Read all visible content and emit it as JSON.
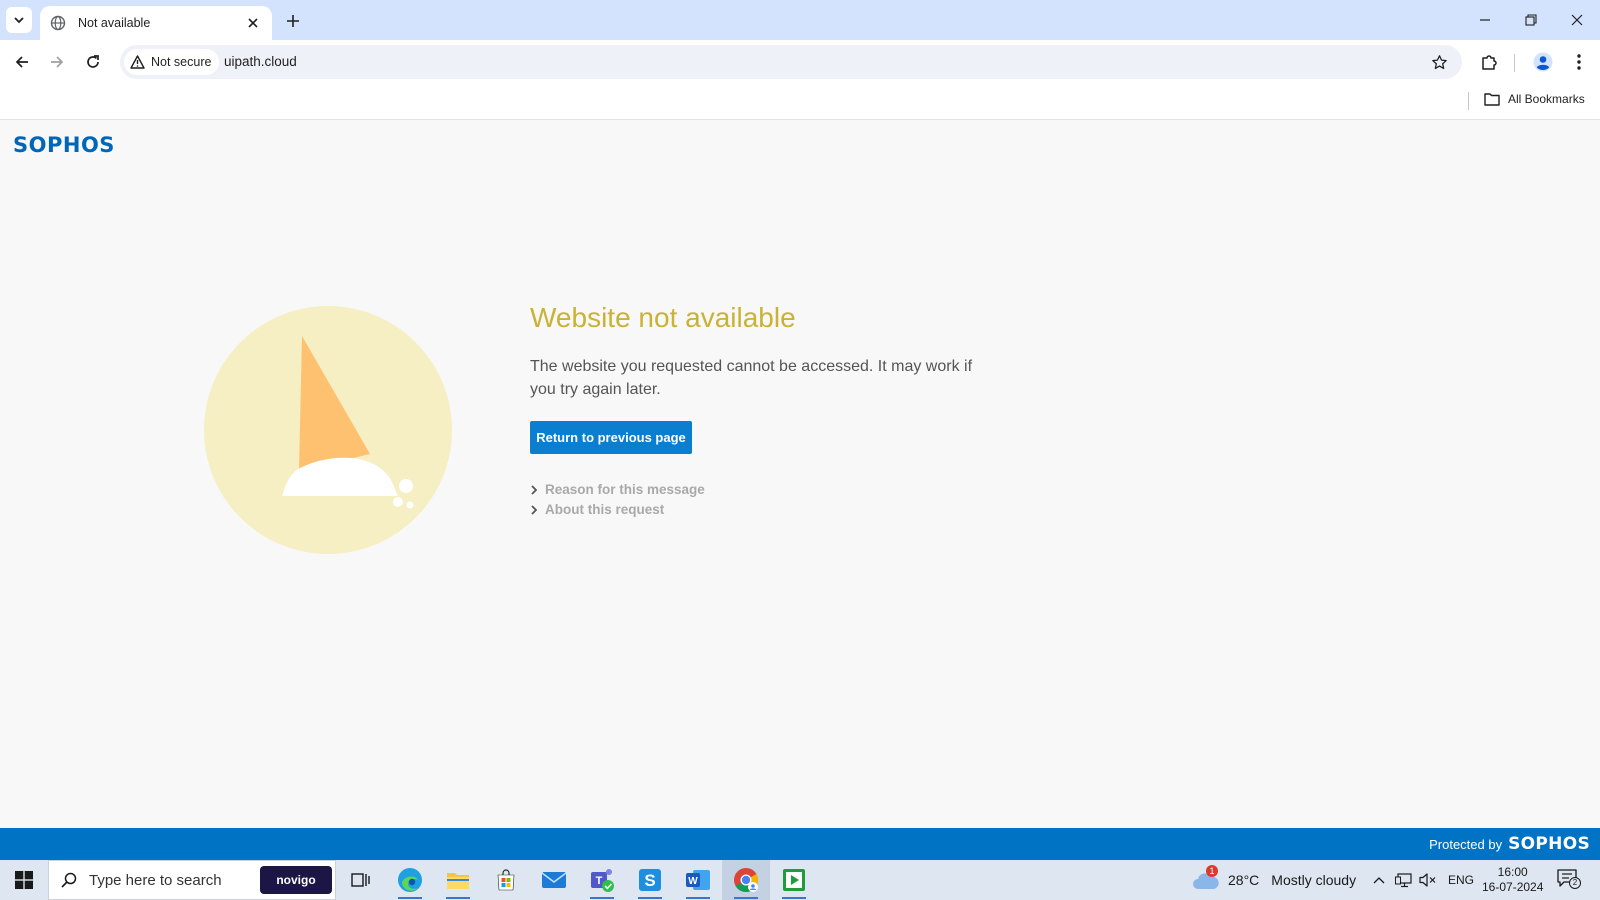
{
  "browser": {
    "tab_title": "Not available",
    "address_chip": "Not secure",
    "url": "uipath.cloud",
    "bookmarks_label": "All Bookmarks"
  },
  "page": {
    "logo": "SOPHOS",
    "heading": "Website not available",
    "message": "The website you requested cannot be accessed. It may work if you try again later.",
    "return_button": "Return to previous page",
    "details": [
      {
        "label": "Reason for this message"
      },
      {
        "label": "About this request"
      }
    ],
    "footer_label": "Protected by",
    "footer_logo": "SOPHOS"
  },
  "taskbar": {
    "search_placeholder": "Type here to search",
    "novigo_label": "novigo",
    "weather_badge": "1",
    "temperature": "28°C",
    "weather_desc": "Mostly cloudy",
    "language": "ENG",
    "time": "16:00",
    "date": "16-07-2024",
    "notification_count": "2"
  },
  "colors": {
    "accent_blue": "#0b7ed0",
    "sophos_blue": "#0066b8",
    "heading_gold": "#c9b236",
    "illustration_circle": "#f5efc3",
    "sail_orange": "#fec170"
  }
}
